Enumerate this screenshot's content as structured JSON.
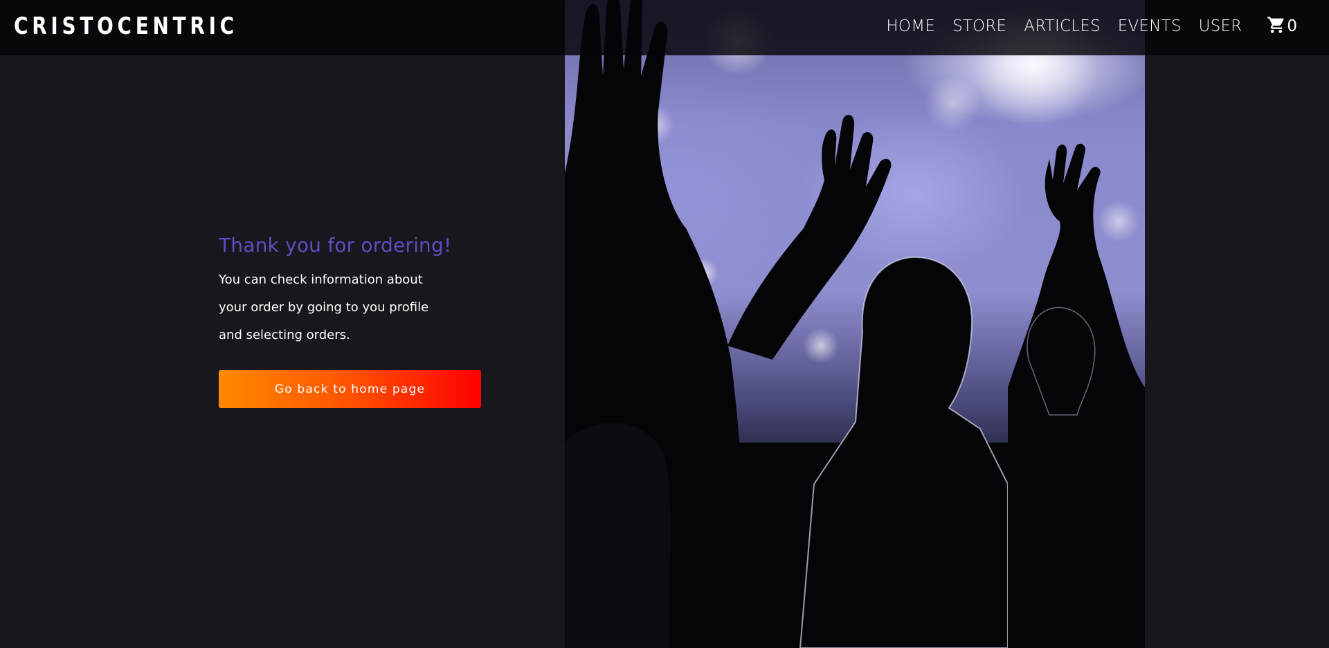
{
  "header": {
    "logo": "CRISTOCENTRIC",
    "nav": [
      {
        "label": "HOME"
      },
      {
        "label": "STORE"
      },
      {
        "label": "ARTICLES"
      },
      {
        "label": "EVENTS"
      },
      {
        "label": "USER"
      }
    ],
    "cart_icon": "shopping-cart-icon",
    "cart_count": "0"
  },
  "main": {
    "title": "Thank you for ordering!",
    "body": "You can check information about your order by going to you profile and selecting orders.",
    "button_label": "Go back to home page"
  },
  "hero": {
    "image": "concert-crowd-raised-hands-silhouette"
  },
  "colors": {
    "background": "#18171d",
    "title": "#5b4fc3",
    "button_start": "#ff8a00",
    "button_end": "#ff0000"
  }
}
